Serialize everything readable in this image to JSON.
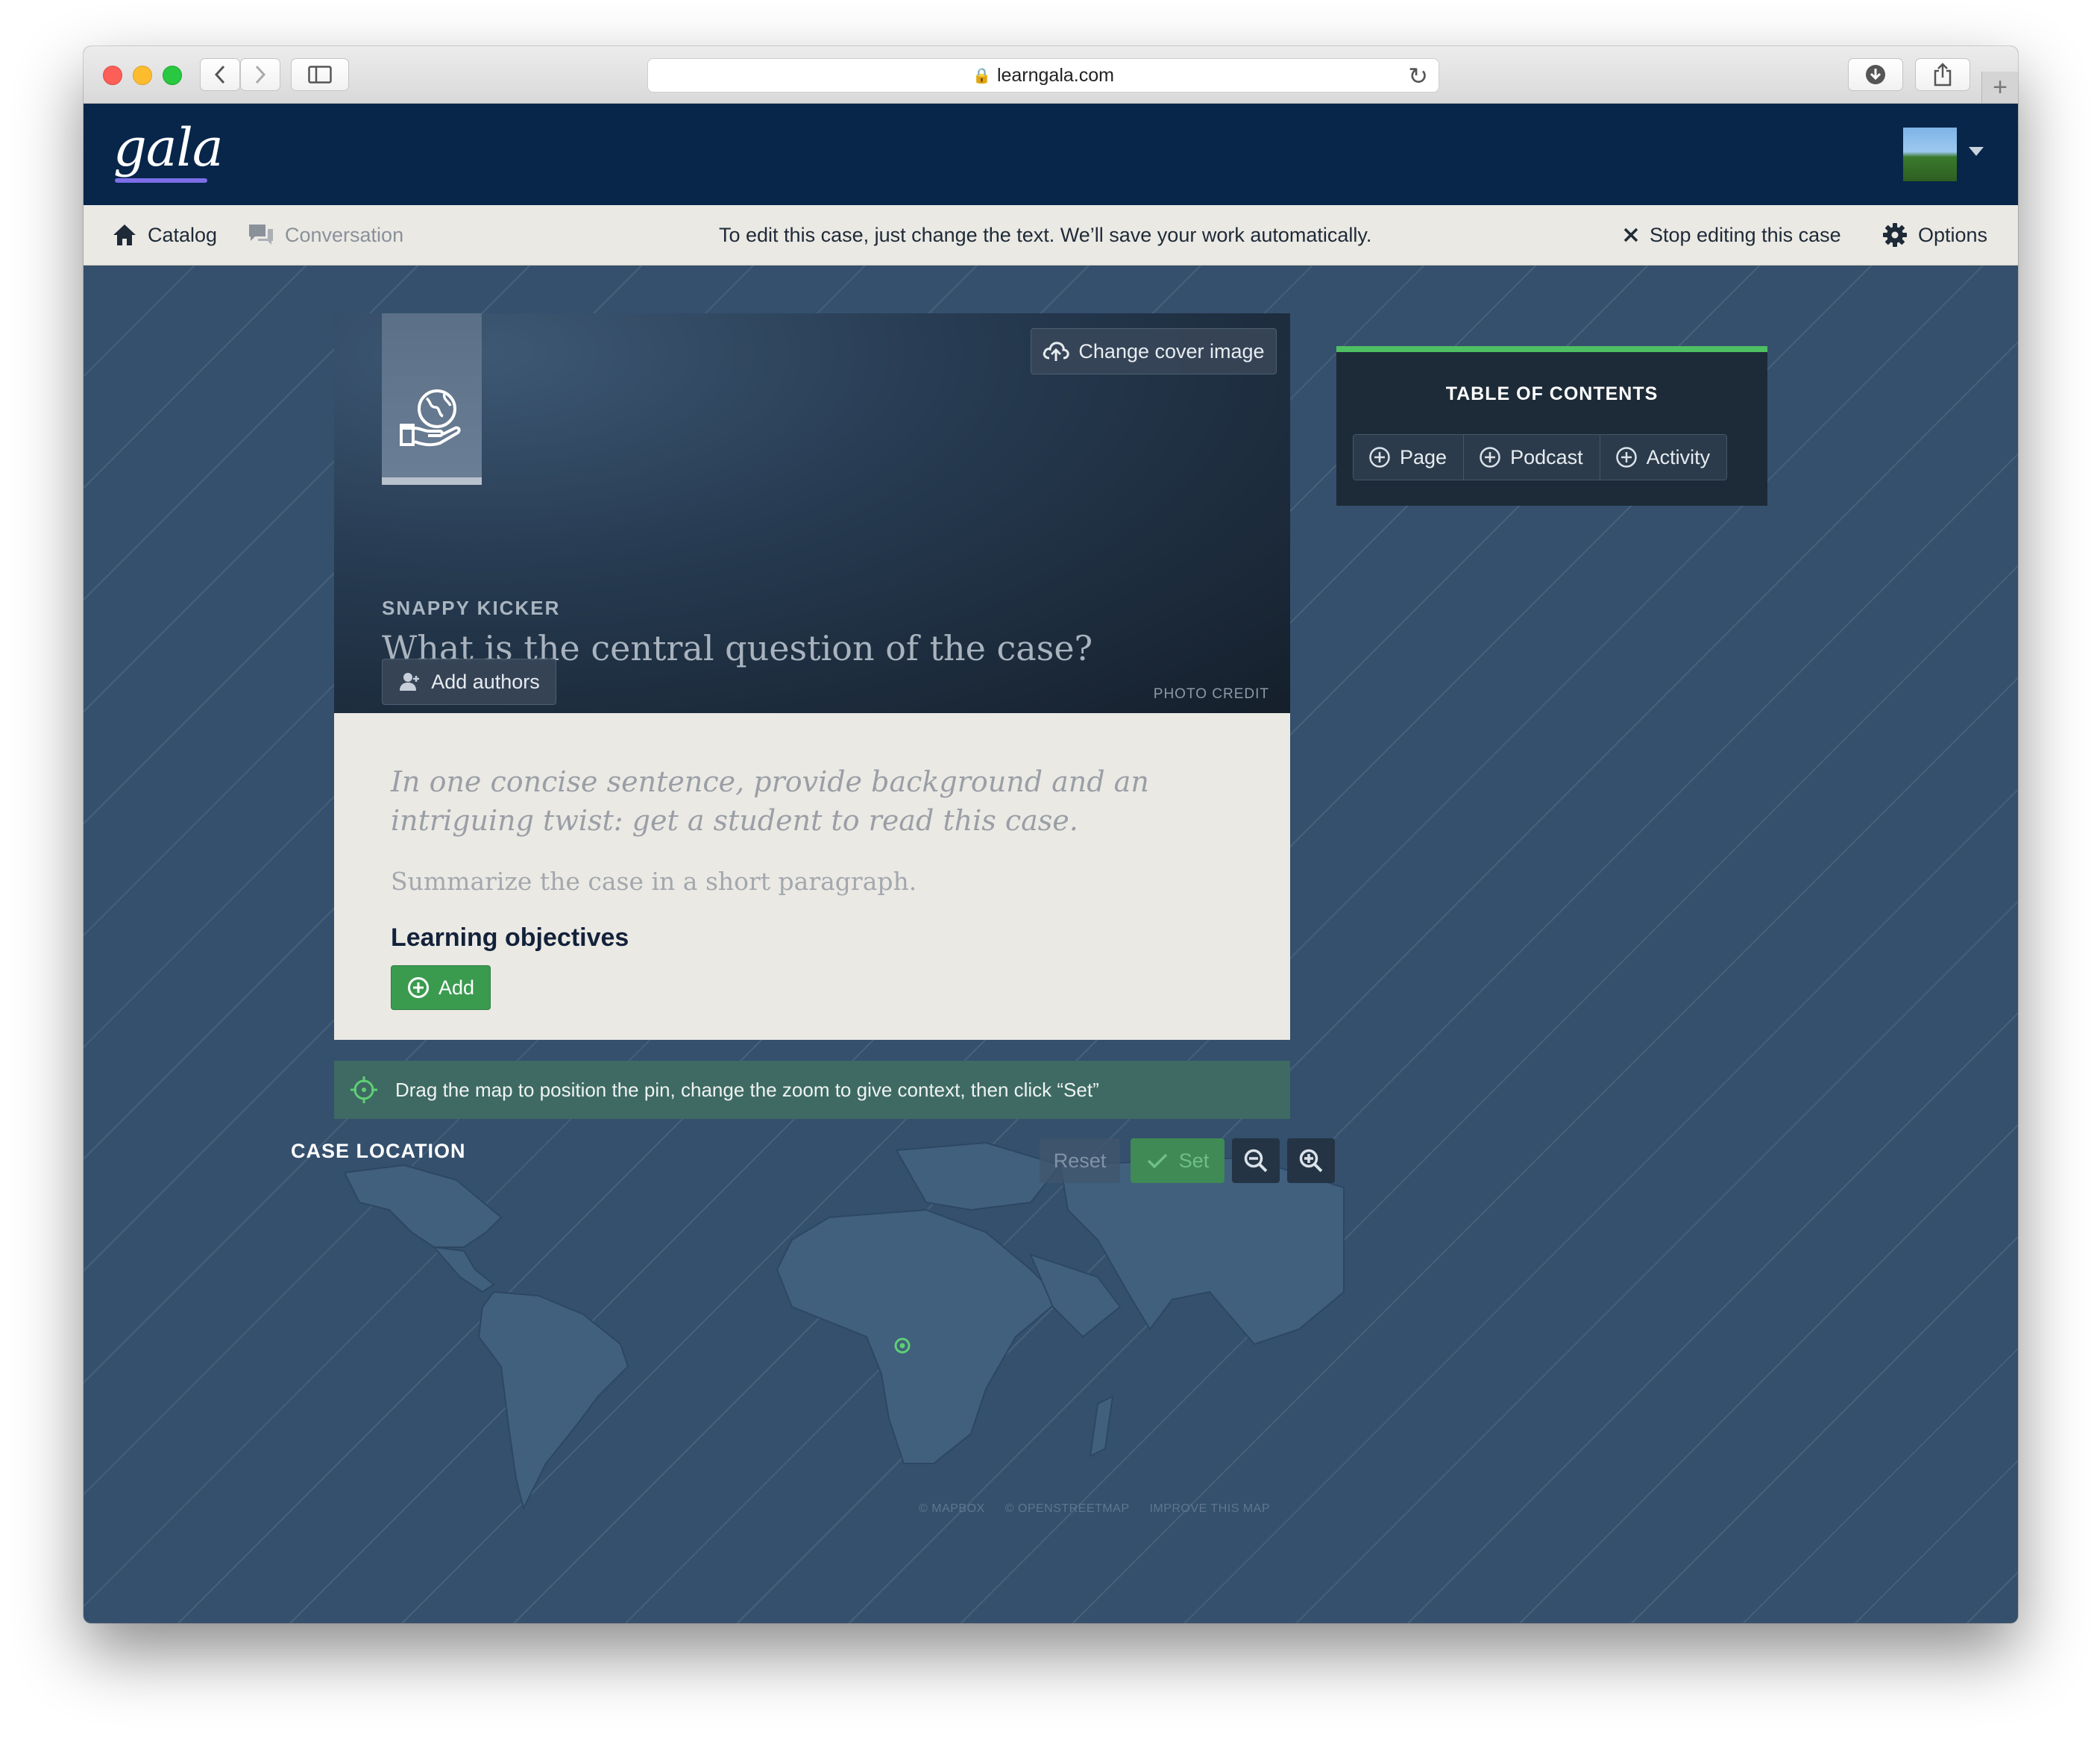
{
  "browser": {
    "url": "learngala.com"
  },
  "app": {
    "logo": "gala"
  },
  "edit_toolbar": {
    "catalog": "Catalog",
    "conversation": "Conversation",
    "message": "To edit this case, just change the text. We’ll save your work automatically.",
    "stop_editing": "Stop editing this case",
    "options": "Options"
  },
  "cover": {
    "change_cover": "Change cover image",
    "kicker": "SNAPPY KICKER",
    "question": "What is the central question of the case?",
    "add_authors": "Add authors",
    "photo_credit": "PHOTO CREDIT"
  },
  "summary": {
    "tagline": "In one concise sentence, provide background and an intriguing twist: get a student to read this case.",
    "paragraph": "Summarize the case in a short paragraph.",
    "learning_objectives": "Learning objectives",
    "add": "Add"
  },
  "map": {
    "hint": "Drag the map to position the pin, change the zoom to give context, then click “Set”",
    "title": "CASE LOCATION",
    "reset": "Reset",
    "set": "Set",
    "attribution": [
      "© MAPBOX",
      "© OPENSTREETMAP",
      "IMPROVE THIS MAP"
    ]
  },
  "toc": {
    "title": "TABLE OF CONTENTS",
    "buttons": [
      "Page",
      "Podcast",
      "Activity"
    ]
  },
  "colors": {
    "header_bg": "#07264a",
    "page_bg": "#34506d",
    "accent_green": "#3a9b4f",
    "toc_accent": "#4fbf63"
  },
  "icons": [
    "home-icon",
    "conversation-icon",
    "close-icon",
    "gear-icon",
    "cloud-upload-icon",
    "globe-hand-icon",
    "user-icon",
    "plus-circle-icon",
    "crosshair-icon",
    "check-icon",
    "zoom-out-icon",
    "zoom-in-icon",
    "map-pin-icon"
  ]
}
